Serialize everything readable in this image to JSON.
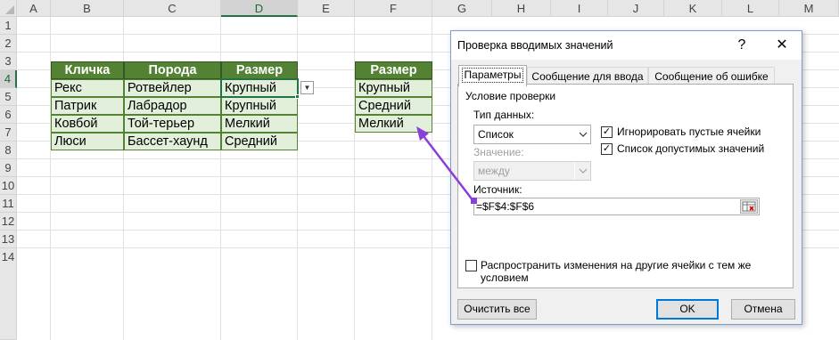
{
  "sheet": {
    "columns": [
      "A",
      "B",
      "C",
      "D",
      "E",
      "F",
      "G",
      "H",
      "I",
      "J",
      "K",
      "L",
      "M"
    ],
    "rows": [
      "1",
      "2",
      "3",
      "4",
      "5",
      "6",
      "7",
      "8",
      "9",
      "10",
      "11",
      "12",
      "13",
      "14"
    ],
    "selected_column": "D",
    "selected_row": "4"
  },
  "table1": {
    "headers": [
      "Кличка",
      "Порода",
      "Размер"
    ],
    "rows": [
      [
        "Рекс",
        "Ротвейлер",
        "Крупный"
      ],
      [
        "Патрик",
        "Лабрадор",
        "Крупный"
      ],
      [
        "Ковбой",
        "Той-терьер",
        "Мелкий"
      ],
      [
        "Люси",
        "Бассет-хаунд",
        "Средний"
      ]
    ]
  },
  "table2": {
    "header": "Размер",
    "rows": [
      "Крупный",
      "Средний",
      "Мелкий"
    ]
  },
  "dialog": {
    "title": "Проверка вводимых значений",
    "help": "?",
    "close": "✕",
    "tabs": [
      "Параметры",
      "Сообщение для ввода",
      "Сообщение об ошибке"
    ],
    "group_title": "Условие проверки",
    "data_type_label": "Тип данных:",
    "data_type_value": "Список",
    "value_label": "Значение:",
    "value_value": "между",
    "ignore_blank_label": "Игнорировать пустые ячейки",
    "in_cell_dropdown_label": "Список допустимых значений",
    "source_label": "Источник:",
    "source_value": "=$F$4:$F$6",
    "apply_all_label_line1": "Распространить изменения на другие ячейки с тем же",
    "apply_all_label_line2": "условием",
    "clear_all": "Очистить все",
    "ok": "OK",
    "cancel": "Отмена"
  },
  "colors": {
    "table_header": "#548235",
    "table_fill": "#e2efda",
    "arrow": "#8b3fd9",
    "selection": "#217346"
  }
}
